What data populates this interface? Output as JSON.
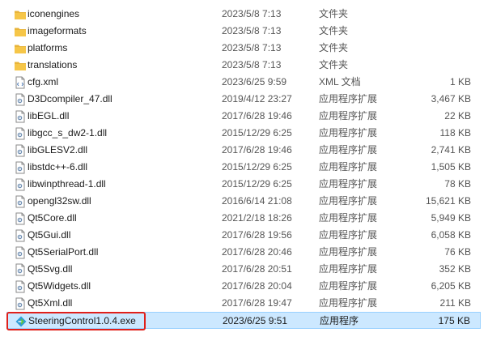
{
  "colors": {
    "folder": "#f6c648",
    "selected_bg": "#cce8ff",
    "selected_border": "#99d1ff",
    "highlight": "#e0201b",
    "secondary_text": "#555555"
  },
  "files": [
    {
      "name": "iconengines",
      "date": "2023/5/8 7:13",
      "type": "文件夹",
      "size": "",
      "icon": "folder-icon"
    },
    {
      "name": "imageformats",
      "date": "2023/5/8 7:13",
      "type": "文件夹",
      "size": "",
      "icon": "folder-icon"
    },
    {
      "name": "platforms",
      "date": "2023/5/8 7:13",
      "type": "文件夹",
      "size": "",
      "icon": "folder-icon"
    },
    {
      "name": "translations",
      "date": "2023/5/8 7:13",
      "type": "文件夹",
      "size": "",
      "icon": "folder-icon"
    },
    {
      "name": "cfg.xml",
      "date": "2023/6/25 9:59",
      "type": "XML 文档",
      "size": "1 KB",
      "icon": "xml-file-icon"
    },
    {
      "name": "D3Dcompiler_47.dll",
      "date": "2019/4/12 23:27",
      "type": "应用程序扩展",
      "size": "3,467 KB",
      "icon": "dll-file-icon"
    },
    {
      "name": "libEGL.dll",
      "date": "2017/6/28 19:46",
      "type": "应用程序扩展",
      "size": "22 KB",
      "icon": "dll-file-icon"
    },
    {
      "name": "libgcc_s_dw2-1.dll",
      "date": "2015/12/29 6:25",
      "type": "应用程序扩展",
      "size": "118 KB",
      "icon": "dll-file-icon"
    },
    {
      "name": "libGLESV2.dll",
      "date": "2017/6/28 19:46",
      "type": "应用程序扩展",
      "size": "2,741 KB",
      "icon": "dll-file-icon"
    },
    {
      "name": "libstdc++-6.dll",
      "date": "2015/12/29 6:25",
      "type": "应用程序扩展",
      "size": "1,505 KB",
      "icon": "dll-file-icon"
    },
    {
      "name": "libwinpthread-1.dll",
      "date": "2015/12/29 6:25",
      "type": "应用程序扩展",
      "size": "78 KB",
      "icon": "dll-file-icon"
    },
    {
      "name": "opengl32sw.dll",
      "date": "2016/6/14 21:08",
      "type": "应用程序扩展",
      "size": "15,621 KB",
      "icon": "dll-file-icon"
    },
    {
      "name": "Qt5Core.dll",
      "date": "2021/2/18 18:26",
      "type": "应用程序扩展",
      "size": "5,949 KB",
      "icon": "dll-file-icon"
    },
    {
      "name": "Qt5Gui.dll",
      "date": "2017/6/28 19:56",
      "type": "应用程序扩展",
      "size": "6,058 KB",
      "icon": "dll-file-icon"
    },
    {
      "name": "Qt5SerialPort.dll",
      "date": "2017/6/28 20:46",
      "type": "应用程序扩展",
      "size": "76 KB",
      "icon": "dll-file-icon"
    },
    {
      "name": "Qt5Svg.dll",
      "date": "2017/6/28 20:51",
      "type": "应用程序扩展",
      "size": "352 KB",
      "icon": "dll-file-icon"
    },
    {
      "name": "Qt5Widgets.dll",
      "date": "2017/6/28 20:04",
      "type": "应用程序扩展",
      "size": "6,205 KB",
      "icon": "dll-file-icon"
    },
    {
      "name": "Qt5Xml.dll",
      "date": "2017/6/28 19:47",
      "type": "应用程序扩展",
      "size": "211 KB",
      "icon": "dll-file-icon"
    },
    {
      "name": "SteeringControl1.0.4.exe",
      "date": "2023/6/25 9:51",
      "type": "应用程序",
      "size": "175 KB",
      "icon": "app-exe-icon",
      "selected": true
    }
  ]
}
